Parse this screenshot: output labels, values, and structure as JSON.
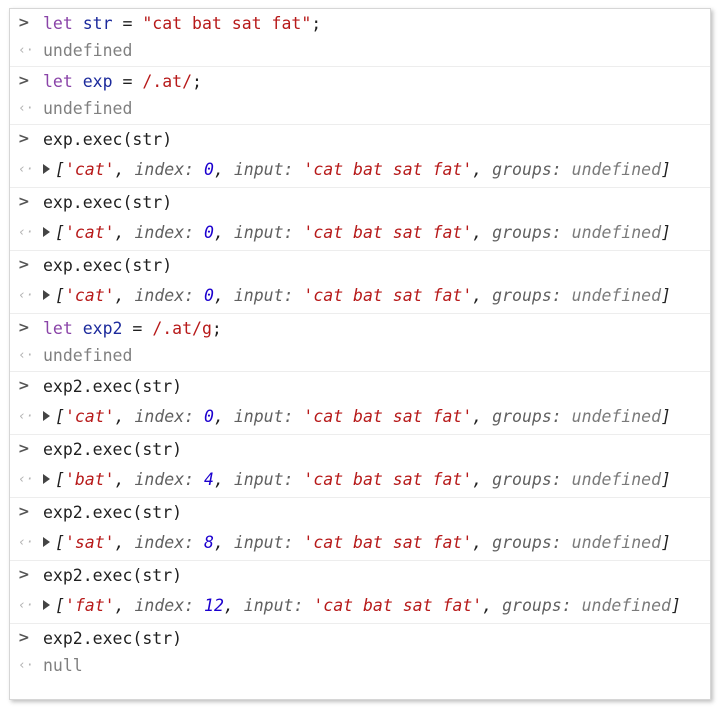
{
  "prompt_in": ">",
  "prompt_out": "‹·",
  "entries": [
    {
      "input": {
        "kw": "let",
        "name": "str",
        "op": " = ",
        "value": "\"cat bat sat fat\"",
        "end": ";"
      },
      "output": "undefined"
    },
    {
      "input": {
        "kw": "let",
        "name": "exp",
        "op": " = ",
        "value": "/.at/",
        "end": ";"
      },
      "output": "undefined"
    },
    {
      "input_text": "exp.exec(str)",
      "result": {
        "match": "'cat'",
        "index": "0",
        "input": "'cat bat sat fat'",
        "groups": "undefined"
      }
    },
    {
      "input_text": "exp.exec(str)",
      "result": {
        "match": "'cat'",
        "index": "0",
        "input": "'cat bat sat fat'",
        "groups": "undefined"
      }
    },
    {
      "input_text": "exp.exec(str)",
      "result": {
        "match": "'cat'",
        "index": "0",
        "input": "'cat bat sat fat'",
        "groups": "undefined"
      }
    },
    {
      "input": {
        "kw": "let",
        "name": "exp2",
        "op": " = ",
        "value": "/.at/g",
        "end": ";"
      },
      "output": "undefined"
    },
    {
      "input_text": "exp2.exec(str)",
      "result": {
        "match": "'cat'",
        "index": "0",
        "input": "'cat bat sat fat'",
        "groups": "undefined"
      }
    },
    {
      "input_text": "exp2.exec(str)",
      "result": {
        "match": "'bat'",
        "index": "4",
        "input": "'cat bat sat fat'",
        "groups": "undefined"
      }
    },
    {
      "input_text": "exp2.exec(str)",
      "result": {
        "match": "'sat'",
        "index": "8",
        "input": "'cat bat sat fat'",
        "groups": "undefined"
      }
    },
    {
      "input_text": "exp2.exec(str)",
      "result": {
        "match": "'fat'",
        "index": "12",
        "input": "'cat bat sat fat'",
        "groups": "undefined"
      }
    },
    {
      "input_text": "exp2.exec(str)",
      "output": "null"
    }
  ],
  "labels": {
    "index": "index:",
    "input": "input:",
    "groups": "groups:",
    "open": "[",
    "close": "]",
    "sep": ", "
  }
}
